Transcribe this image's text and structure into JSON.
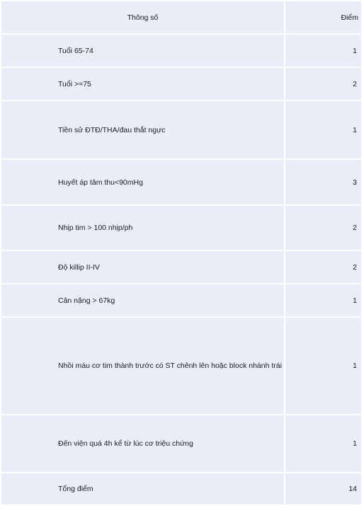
{
  "table": {
    "header": {
      "param": "Thông số",
      "score": "Điểm"
    },
    "rows": [
      {
        "param": "Tuổi 65-74",
        "score": "1"
      },
      {
        "param": "Tuổi >=75",
        "score": "2"
      },
      {
        "param": "Tiền sử ĐTĐ/THA/đau thắt ngực",
        "score": "1"
      },
      {
        "param": "Huyết áp tâm thu<90mHg",
        "score": "3"
      },
      {
        "param": "Nhịp tim > 100 nhịp/ph",
        "score": "2"
      },
      {
        "param": "Độ killip II-IV",
        "score": "2"
      },
      {
        "param": "Cân nặng > 67kg",
        "score": "1"
      },
      {
        "param": "Nhồi máu cơ tim thành trước có ST chênh lên hoặc block nhánh trái",
        "score": "1"
      },
      {
        "param": "Đến viện quá 4h kể từ lúc cơ triệu chứng",
        "score": "1"
      },
      {
        "param": "Tổng điểm",
        "score": "14"
      }
    ]
  }
}
